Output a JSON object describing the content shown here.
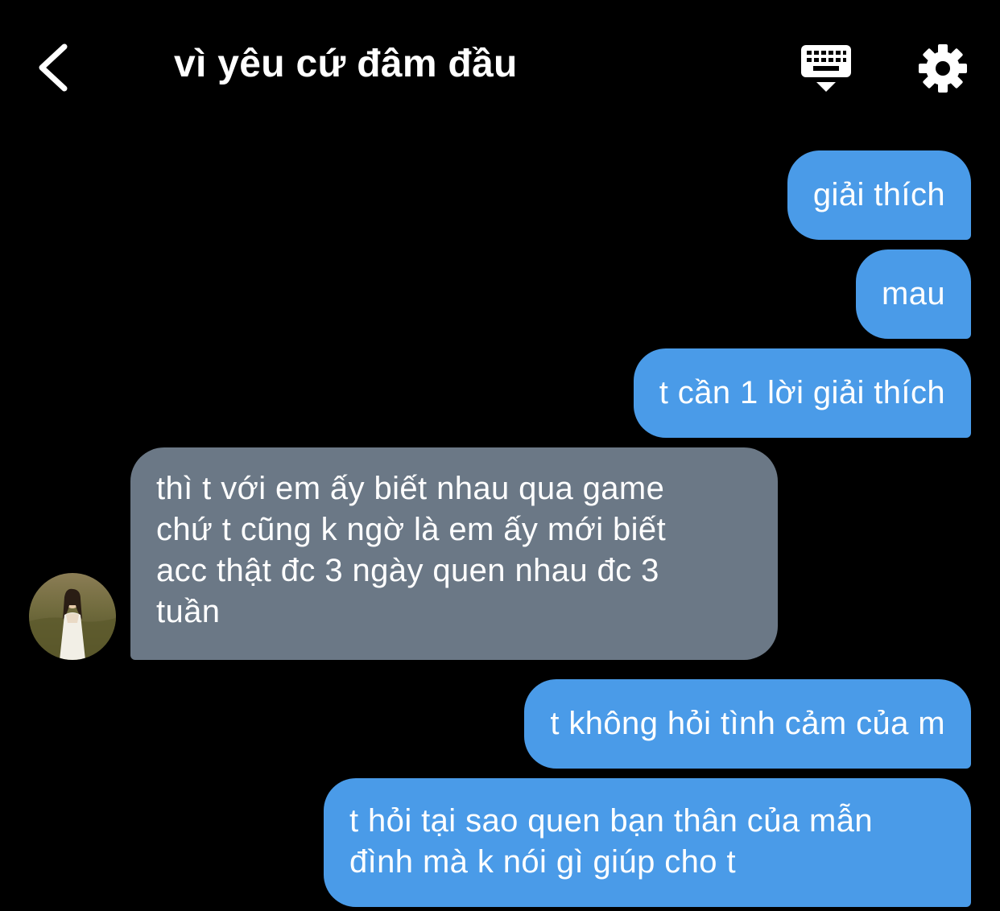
{
  "header": {
    "title": "vì yêu cứ đâm đầu"
  },
  "messages": [
    {
      "sender": "me",
      "text": "giải thích"
    },
    {
      "sender": "me",
      "text": "mau"
    },
    {
      "sender": "me",
      "text": "t cần 1 lời giải thích"
    },
    {
      "sender": "other",
      "text": "thì t với em ấy biết nhau qua game\nchứ t cũng k ngờ là em ấy mới biết\nacc thật đc 3 ngày quen nhau đc 3\ntuần"
    },
    {
      "sender": "me",
      "text": "t không hỏi tình cảm của m"
    },
    {
      "sender": "me",
      "text": "t hỏi tại sao quen bạn thân của mẫn\nđình mà k nói gì giúp cho t"
    }
  ],
  "colors": {
    "background": "#000000",
    "sent_bubble": "#4a9be8",
    "received_bubble": "#6b7886",
    "text": "#ffffff"
  },
  "icons": {
    "back": "chevron-left-icon",
    "keyboard": "keyboard-icon",
    "settings": "gear-icon",
    "avatar": "avatar"
  }
}
